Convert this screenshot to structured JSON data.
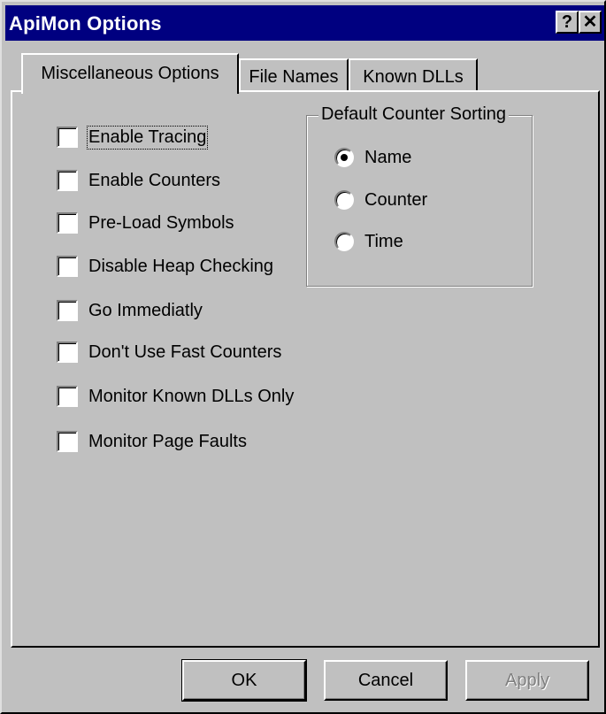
{
  "window": {
    "title": "ApiMon Options",
    "help_glyph": "?",
    "close_glyph": "✕"
  },
  "tabs": [
    {
      "label": "Miscellaneous Options",
      "active": true
    },
    {
      "label": "File Names",
      "active": false
    },
    {
      "label": "Known DLLs",
      "active": false
    }
  ],
  "options": [
    {
      "label": "Enable Tracing",
      "checked": false
    },
    {
      "label": "Enable Counters",
      "checked": false
    },
    {
      "label": "Pre-Load Symbols",
      "checked": false
    },
    {
      "label": "Disable Heap Checking",
      "checked": false
    },
    {
      "label": "Go Immediatly",
      "checked": false
    },
    {
      "label": "Don't Use Fast Counters",
      "checked": false
    },
    {
      "label": "Monitor Known DLLs Only",
      "checked": false
    },
    {
      "label": "Monitor Page Faults",
      "checked": false
    }
  ],
  "sorting": {
    "title": "Default Counter Sorting",
    "options": [
      {
        "label": "Name",
        "selected": true
      },
      {
        "label": "Counter",
        "selected": false
      },
      {
        "label": "Time",
        "selected": false
      }
    ]
  },
  "buttons": {
    "ok": "OK",
    "cancel": "Cancel",
    "apply": "Apply"
  },
  "colors": {
    "titlebar": "#000080",
    "face": "#c0c0c0"
  }
}
